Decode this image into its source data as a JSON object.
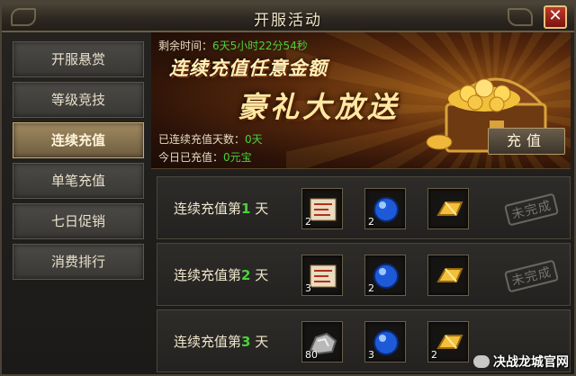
{
  "window": {
    "title": "开服活动",
    "close_label": "✕"
  },
  "sidebar": {
    "items": [
      {
        "label": "开服悬赏",
        "active": false
      },
      {
        "label": "等级竞技",
        "active": false
      },
      {
        "label": "连续充值",
        "active": true
      },
      {
        "label": "单笔充值",
        "active": false
      },
      {
        "label": "七日促销",
        "active": false
      },
      {
        "label": "消费排行",
        "active": false
      }
    ]
  },
  "banner": {
    "timer_label": "剩余时间：",
    "timer_value": "6天5小时22分54秒",
    "headline1": "连续充值任意金额",
    "headline2": "豪礼大放送",
    "days_label": "已连续充值天数：",
    "days_value": "0天",
    "today_label": "今日已充值：",
    "today_value": "0元宝",
    "recharge_button": "充值"
  },
  "rewards": [
    {
      "prefix": "连续充值第",
      "day": "1",
      "suffix": "天",
      "status": "未完成",
      "items": [
        {
          "icon": "scroll-icon",
          "qty": "2"
        },
        {
          "icon": "blue-orb-icon",
          "qty": "2"
        },
        {
          "icon": "gold-bar-icon",
          "qty": ""
        }
      ]
    },
    {
      "prefix": "连续充值第",
      "day": "2",
      "suffix": "天",
      "status": "未完成",
      "items": [
        {
          "icon": "scroll-icon",
          "qty": "3"
        },
        {
          "icon": "blue-orb-icon",
          "qty": "2"
        },
        {
          "icon": "gold-bar-icon",
          "qty": ""
        }
      ]
    },
    {
      "prefix": "连续充值第",
      "day": "3",
      "suffix": "天",
      "status": "",
      "items": [
        {
          "icon": "ore-icon",
          "qty": "80"
        },
        {
          "icon": "blue-orb-icon",
          "qty": "3"
        },
        {
          "icon": "gold-bar-icon",
          "qty": "2"
        }
      ]
    }
  ],
  "watermark": "决战龙城官网",
  "colors": {
    "accent_green": "#4ad23a",
    "gold": "#ffe9a2",
    "active_tab": "#a08a62"
  }
}
